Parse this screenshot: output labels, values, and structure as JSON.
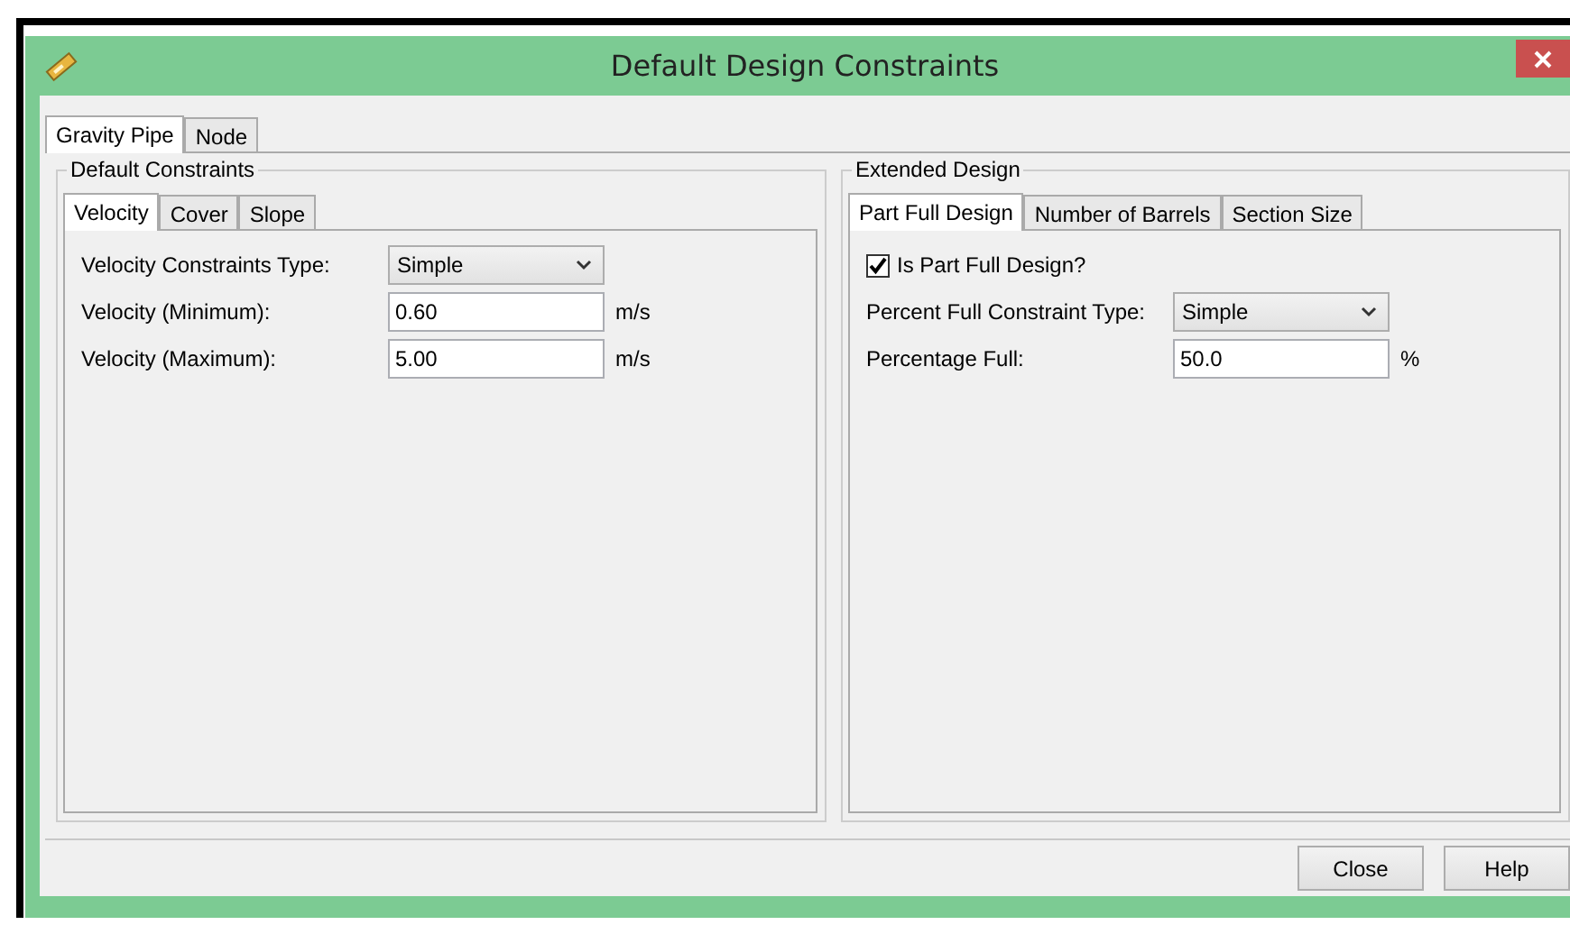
{
  "window": {
    "title": "Default Design Constraints"
  },
  "tabs": [
    {
      "label": "Gravity Pipe",
      "selected": true
    },
    {
      "label": "Node",
      "selected": false
    }
  ],
  "groups": [
    {
      "title": "Default Constraints",
      "tabs": [
        {
          "label": "Velocity",
          "selected": true
        },
        {
          "label": "Cover",
          "selected": false
        },
        {
          "label": "Slope",
          "selected": false
        }
      ],
      "fields": [
        {
          "kind": "dropdown",
          "label": "Velocity Constraints Type:",
          "value": "Simple"
        },
        {
          "kind": "text",
          "label": "Velocity (Minimum):",
          "value": "0.60",
          "unit": "m/s"
        },
        {
          "kind": "text",
          "label": "Velocity (Maximum):",
          "value": "5.00",
          "unit": "m/s"
        }
      ]
    },
    {
      "title": "Extended Design",
      "tabs": [
        {
          "label": "Part Full Design",
          "selected": true
        },
        {
          "label": "Number of Barrels",
          "selected": false
        },
        {
          "label": "Section Size",
          "selected": false
        }
      ],
      "fields": [
        {
          "kind": "checkbox",
          "label": "Is Part Full Design?",
          "checked": true
        },
        {
          "kind": "dropdown",
          "label": "Percent Full Constraint Type:",
          "value": "Simple"
        },
        {
          "kind": "text",
          "label": "Percentage Full:",
          "value": "50.0",
          "unit": "%"
        }
      ]
    }
  ],
  "buttons": [
    "Close",
    "Help"
  ]
}
